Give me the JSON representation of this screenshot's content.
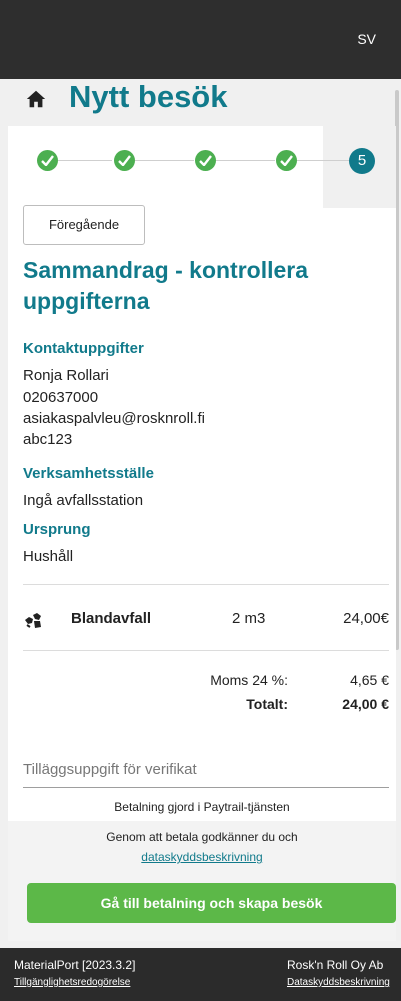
{
  "header": {
    "language": "SV"
  },
  "page": {
    "title": "Nytt besök"
  },
  "stepper": {
    "current_step": "5"
  },
  "nav": {
    "previous_label": "Föregående"
  },
  "summary": {
    "title": "Sammandrag - kontrollera uppgifterna",
    "contact": {
      "heading": "Kontaktuppgifter",
      "name": "Ronja Rollari",
      "phone": "020637000",
      "email": "asiakaspalvleu@rosknroll.fi",
      "code": "abc123"
    },
    "site": {
      "heading": "Verksamhetsställe",
      "value": "Ingå avfallsstation"
    },
    "origin": {
      "heading": "Ursprung",
      "value": "Hushåll"
    }
  },
  "waste_items": [
    {
      "icon": "mixed-waste-icon",
      "name": "Blandavfall",
      "quantity": "2 m3",
      "price": "24,00€"
    }
  ],
  "totals": {
    "tax_label": "Moms 24 %:",
    "tax_value": "4,65 €",
    "total_label": "Totalt:",
    "total_value": "24,00 €"
  },
  "extra_info": {
    "placeholder": "Tilläggsuppgift för verifikat"
  },
  "payment": {
    "note": "Betalning gjord i Paytrail-tjänsten",
    "consent_text": "Genom att betala godkänner du och",
    "consent_link": "dataskyddsbeskrivning",
    "button_label": "Gå till betalning och skapa besök"
  },
  "footer": {
    "left_title": "MaterialPort [2023.3.2]",
    "left_link": "Tillgänglighetsredogörelse",
    "right_title": "Rosk'n Roll Oy Ab",
    "right_link": "Dataskyddsbeskrivning"
  },
  "colors": {
    "primary": "#117a8b",
    "success": "#4caf50",
    "pay_button": "#5cb848",
    "topbar": "#2e2e2e"
  }
}
